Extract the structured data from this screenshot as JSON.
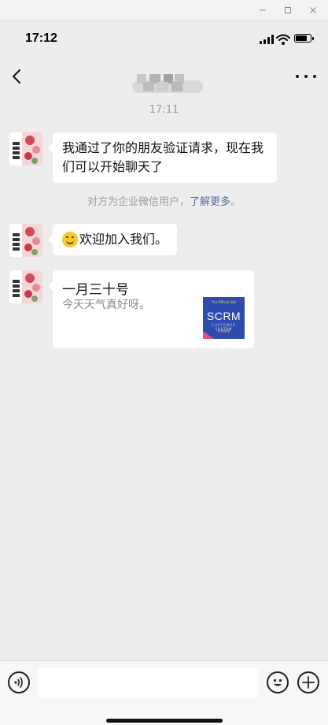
{
  "window": {
    "minimize_icon": "minimize-icon",
    "maximize_icon": "maximize-icon",
    "close_icon": "close-icon"
  },
  "status_bar": {
    "time": "17:12",
    "battery_level": 0.85
  },
  "nav": {
    "back_icon": "chevron-left-icon",
    "title_obscured": true,
    "more_icon": "more-horizontal-icon"
  },
  "chat": {
    "timestamp": "17:11",
    "messages": [
      {
        "type": "text",
        "text": "我通过了你的朋友验证请求，现在我们可以开始聊天了"
      },
      {
        "type": "system",
        "text": "对方为企业微信用户，",
        "link": "了解更多",
        "suffix": "。"
      },
      {
        "type": "text",
        "emoji": "smile-emoji",
        "text": "欢迎加入我们。"
      },
      {
        "type": "link_card",
        "title": "一月三十号",
        "description": "今天天气真好呀。",
        "thumbnail": {
          "top_text": "The Official Site",
          "main_text": "SCRM",
          "sub_text": "CUSTOMER SYSTEM",
          "foot_text": "私域运营",
          "background": "#2e4bb0"
        }
      }
    ]
  },
  "input_bar": {
    "voice_icon": "voice-icon",
    "input_value": "",
    "emoji_icon": "emoji-icon",
    "plus_icon": "plus-icon"
  },
  "colors": {
    "background": "#ededed",
    "bubble": "#ffffff",
    "link": "#576b95",
    "meta_text": "#9a9a9a"
  }
}
